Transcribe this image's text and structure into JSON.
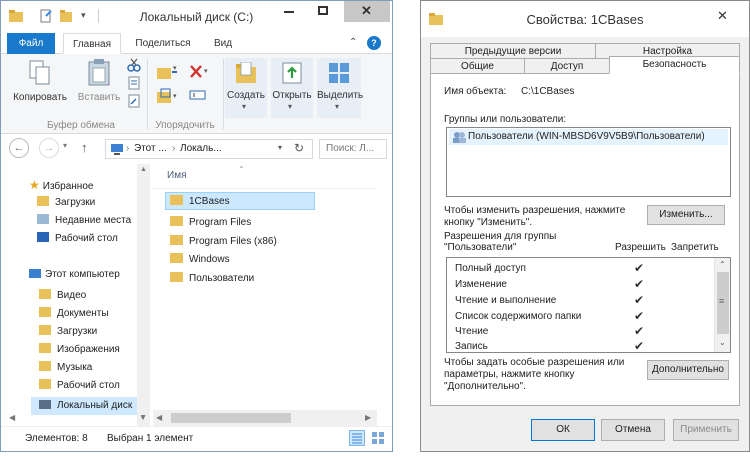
{
  "explorer": {
    "title": "Локальный диск (C:)",
    "ribbon_tabs": [
      "Файл",
      "Главная",
      "Поделиться",
      "Вид"
    ],
    "ribbon": {
      "copy": "Копировать",
      "paste": "Вставить",
      "clipboard_group": "Буфер обмена",
      "organize_group": "Упорядочить",
      "create": "Создать",
      "open": "Открыть",
      "select": "Выделить"
    },
    "address": {
      "crumb1": "Этот ...",
      "crumb2": "Локаль...",
      "search_placeholder": "Поиск: Л..."
    },
    "nav": {
      "favorites": "Избранное",
      "downloads": "Загрузки",
      "recent": "Недавние места",
      "desktop": "Рабочий стол",
      "this_pc": "Этот компьютер",
      "video": "Видео",
      "documents": "Документы",
      "downloads2": "Загрузки",
      "pictures": "Изображения",
      "music": "Музыка",
      "desktop2": "Рабочий стол",
      "local_disk": "Локальный диск"
    },
    "column_name": "Имя",
    "files": [
      "1CBases",
      "Program Files",
      "Program Files (x86)",
      "Windows",
      "Пользователи"
    ],
    "status": {
      "count": "Элементов: 8",
      "selected": "Выбран 1 элемент"
    }
  },
  "props": {
    "title": "Свойства: 1CBases",
    "tabs_row1": [
      "Предыдущие версии",
      "Настройка"
    ],
    "tabs_row2": [
      "Общие",
      "Доступ",
      "Безопасность"
    ],
    "object_label": "Имя объекта:",
    "object_value": "C:\\1CBases",
    "groups_label": "Группы или пользователи:",
    "groups": [
      "Пользователи (WIN-MBSD6V9V5B9\\Пользователи)"
    ],
    "change_hint": "Чтобы изменить разрешения, нажмите кнопку \"Изменить\".",
    "change_button": "Изменить...",
    "perm_label_line1": "Разрешения для группы",
    "perm_label_line2": "\"Пользователи\"",
    "allow_label": "Разрешить",
    "deny_label": "Запретить",
    "permissions": [
      {
        "name": "Полный доступ",
        "allow": true
      },
      {
        "name": "Изменение",
        "allow": true
      },
      {
        "name": "Чтение и выполнение",
        "allow": true
      },
      {
        "name": "Список содержимого папки",
        "allow": true
      },
      {
        "name": "Чтение",
        "allow": true
      },
      {
        "name": "Запись",
        "allow": true
      }
    ],
    "advanced_hint": "Чтобы задать особые разрешения или параметры, нажмите кнопку \"Дополнительно\".",
    "advanced_button": "Дополнительно",
    "ok": "ОК",
    "cancel": "Отмена",
    "apply": "Применить"
  },
  "colors": {
    "accent": "#1979ca",
    "selection": "#cce8ff",
    "folder": "#e8c15b"
  }
}
